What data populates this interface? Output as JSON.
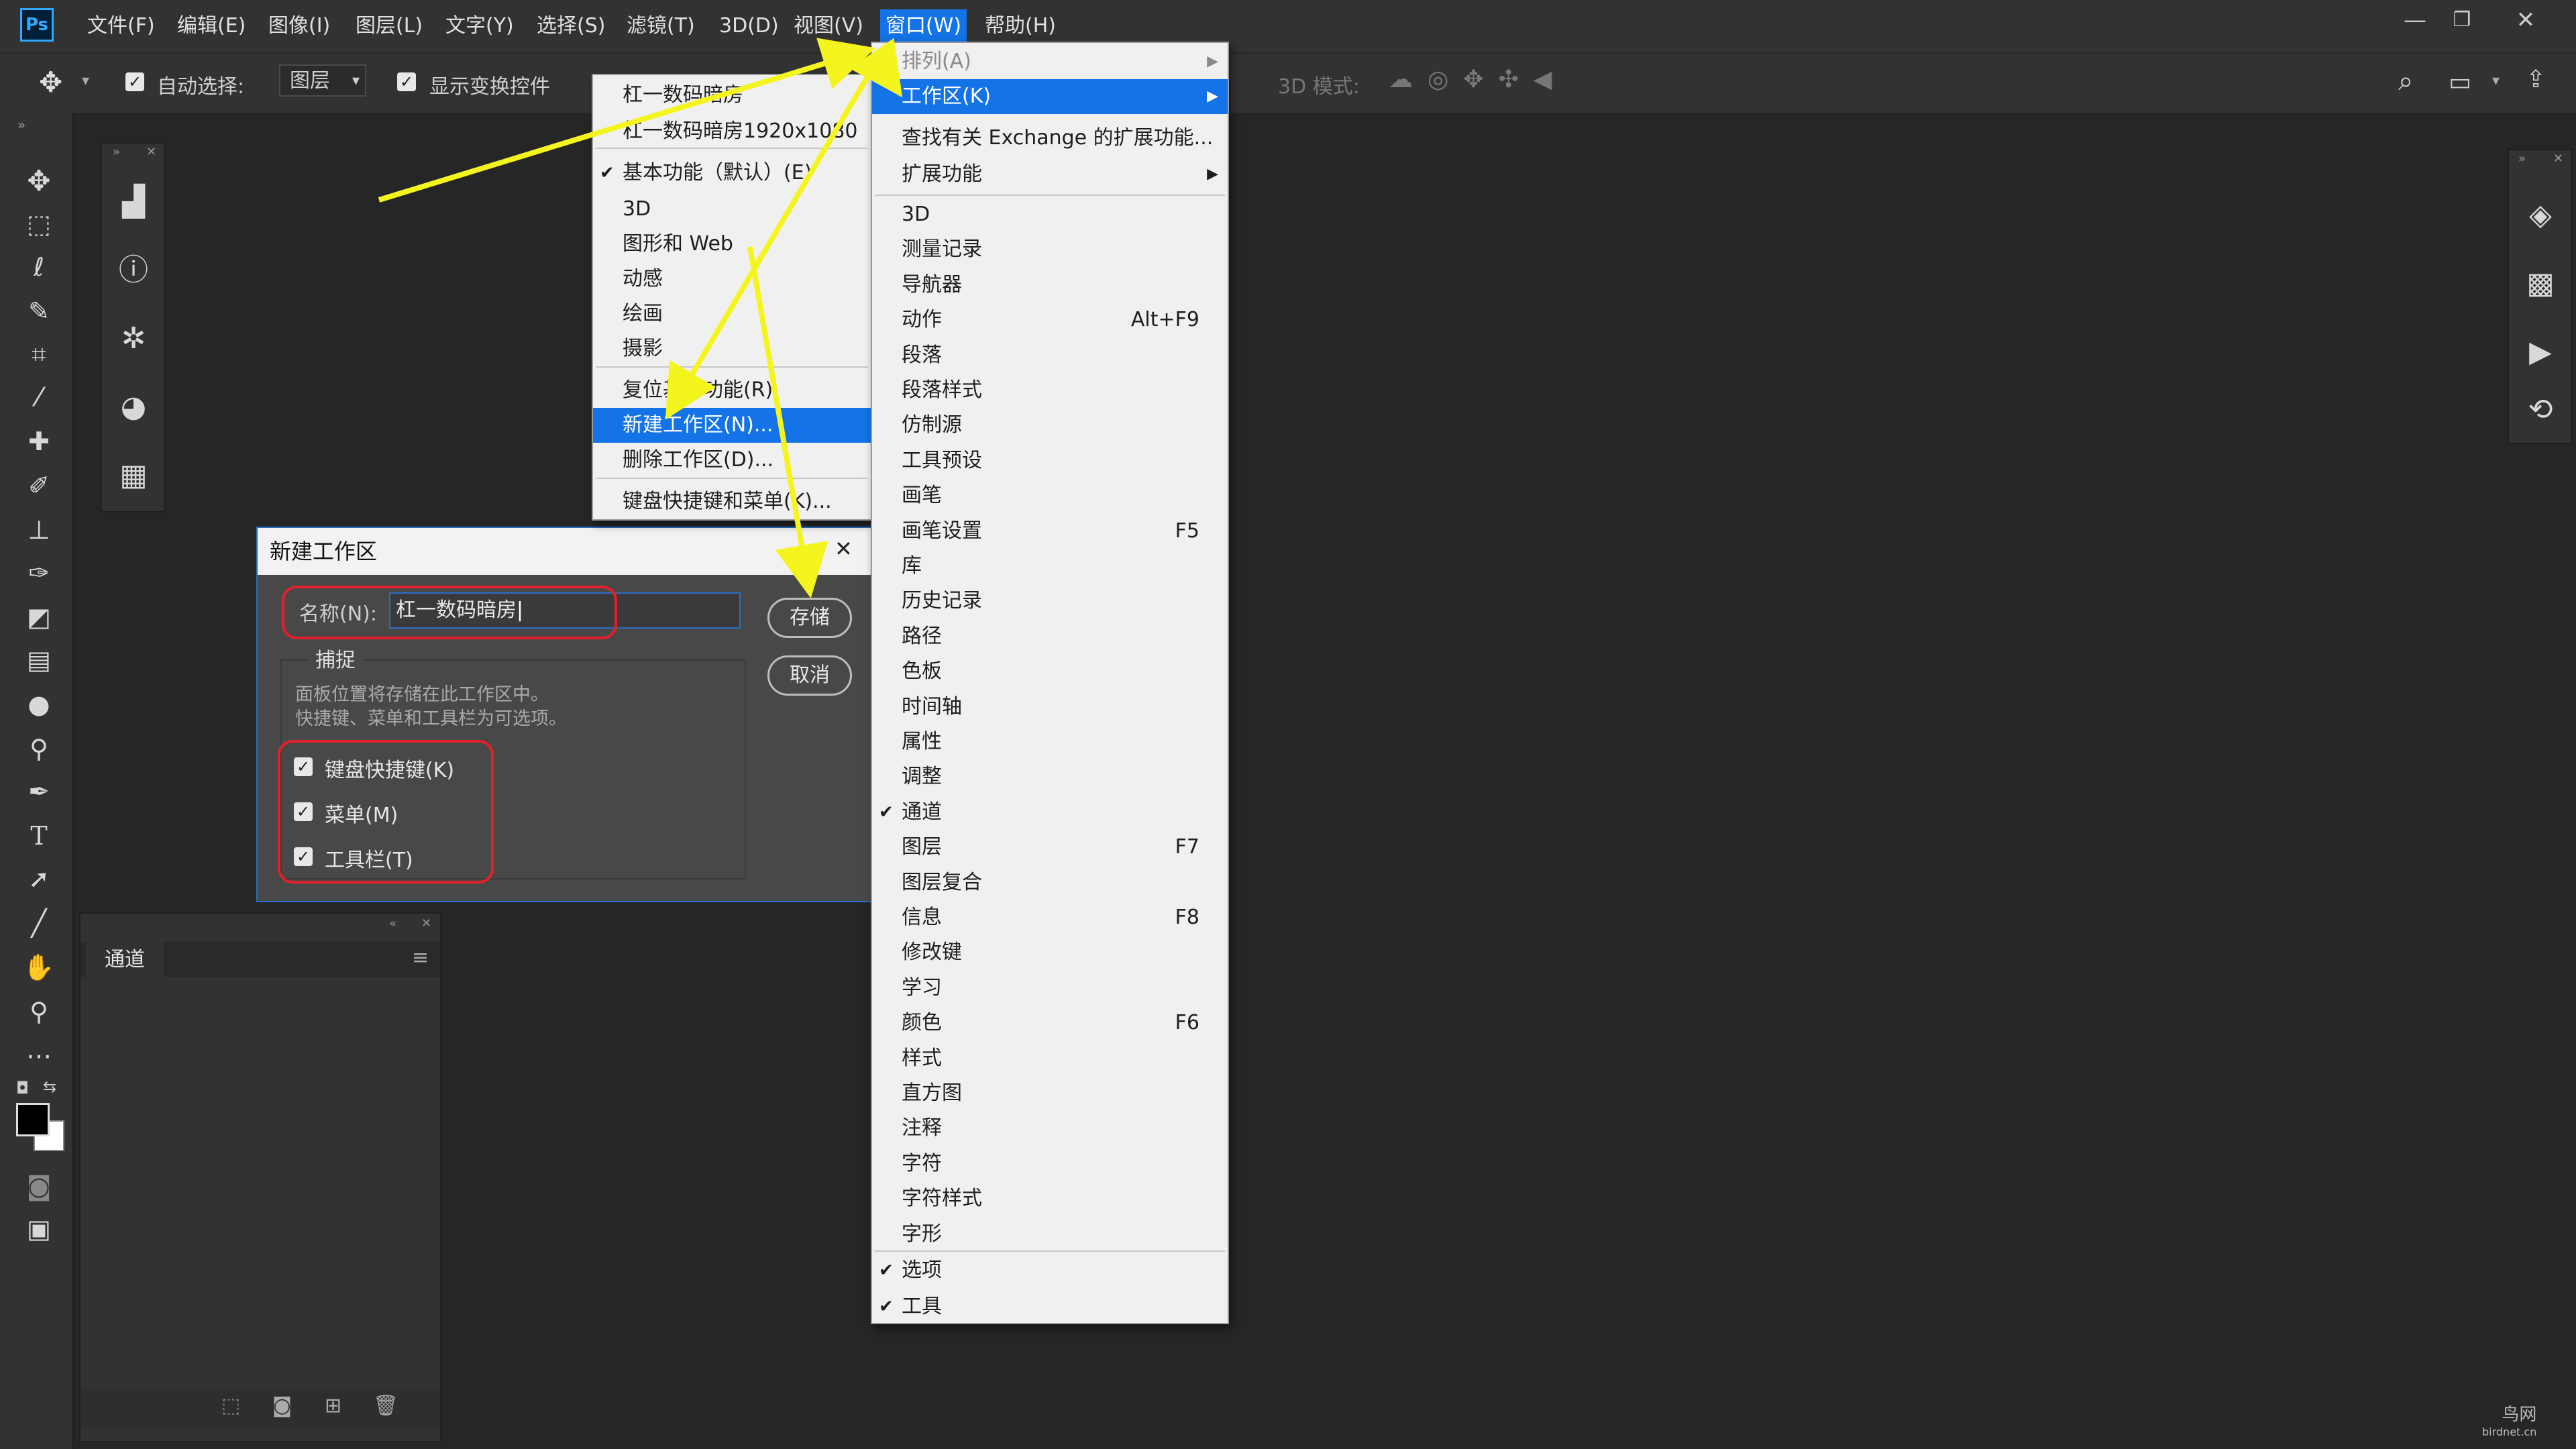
{
  "app": {
    "logo": "Ps"
  },
  "menubar": {
    "items": [
      "文件(F)",
      "编辑(E)",
      "图像(I)",
      "图层(L)",
      "文字(Y)",
      "选择(S)",
      "滤镜(T)",
      "3D(D)",
      "视图(V)",
      "窗口(W)",
      "帮助(H)"
    ],
    "active": "窗口(W)"
  },
  "window_controls": {
    "minimize": "—",
    "restore": "❐",
    "close": "✕"
  },
  "options_bar": {
    "auto_select_label": "自动选择:",
    "auto_select_value": "图层",
    "show_transform_label": "显示变换控件",
    "mode_3d_label": "3D 模式:"
  },
  "workspace_submenu": {
    "items": [
      {
        "label": "杠一数码暗房"
      },
      {
        "label": "杠一数码暗房1920x1080"
      },
      {
        "label": "基本功能（默认）(E)",
        "checked": true
      },
      {
        "label": "3D"
      },
      {
        "label": "图形和 Web"
      },
      {
        "label": "动感"
      },
      {
        "label": "绘画"
      },
      {
        "label": "摄影"
      },
      {
        "label": "复位基本功能(R)"
      },
      {
        "label": "新建工作区(N)...",
        "highlighted": true
      },
      {
        "label": "删除工作区(D)..."
      },
      {
        "label": "键盘快捷键和菜单(K)..."
      }
    ]
  },
  "window_menu": {
    "top": [
      {
        "label": "排列(A)",
        "disabled": true,
        "submenu": true
      },
      {
        "label": "工作区(K)",
        "highlighted": true,
        "submenu": true
      },
      {
        "label": "查找有关 Exchange 的扩展功能..."
      },
      {
        "label": "扩展功能",
        "submenu": true
      }
    ],
    "panels": [
      {
        "label": "3D"
      },
      {
        "label": "测量记录"
      },
      {
        "label": "导航器"
      },
      {
        "label": "动作",
        "shortcut": "Alt+F9"
      },
      {
        "label": "段落"
      },
      {
        "label": "段落样式"
      },
      {
        "label": "仿制源"
      },
      {
        "label": "工具预设"
      },
      {
        "label": "画笔"
      },
      {
        "label": "画笔设置",
        "shortcut": "F5"
      },
      {
        "label": "库"
      },
      {
        "label": "历史记录"
      },
      {
        "label": "路径"
      },
      {
        "label": "色板"
      },
      {
        "label": "时间轴"
      },
      {
        "label": "属性"
      },
      {
        "label": "调整"
      },
      {
        "label": "通道",
        "checked": true
      },
      {
        "label": "图层",
        "shortcut": "F7"
      },
      {
        "label": "图层复合"
      },
      {
        "label": "信息",
        "shortcut": "F8"
      },
      {
        "label": "修改键"
      },
      {
        "label": "学习"
      },
      {
        "label": "颜色",
        "shortcut": "F6"
      },
      {
        "label": "样式"
      },
      {
        "label": "直方图"
      },
      {
        "label": "注释"
      },
      {
        "label": "字符"
      },
      {
        "label": "字符样式"
      },
      {
        "label": "字形"
      }
    ],
    "bottom": [
      {
        "label": "选项",
        "checked": true
      },
      {
        "label": "工具",
        "checked": true
      }
    ]
  },
  "new_workspace_dialog": {
    "title": "新建工作区",
    "close": "✕",
    "name_label": "名称(N):",
    "name_value": "杠一数码暗房",
    "capture_label": "捕捉",
    "description_line1": "面板位置将存储在此工作区中。",
    "description_line2": "快捷键、菜单和工具栏为可选项。",
    "options": [
      {
        "label": "键盘快捷键(K)",
        "checked": true
      },
      {
        "label": "菜单(M)",
        "checked": true
      },
      {
        "label": "工具栏(T)",
        "checked": true
      }
    ],
    "save_button": "存储",
    "cancel_button": "取消"
  },
  "channels_panel": {
    "tab_label": "通道"
  },
  "colors": {
    "accent": "#1473e6",
    "arrow": "#f4f41f",
    "highlight_ring": "#e3202a",
    "canvas_bg": "#262626",
    "chrome": "#323232"
  },
  "watermark": {
    "line1": "鸟网",
    "line2": "birdnet.cn"
  }
}
